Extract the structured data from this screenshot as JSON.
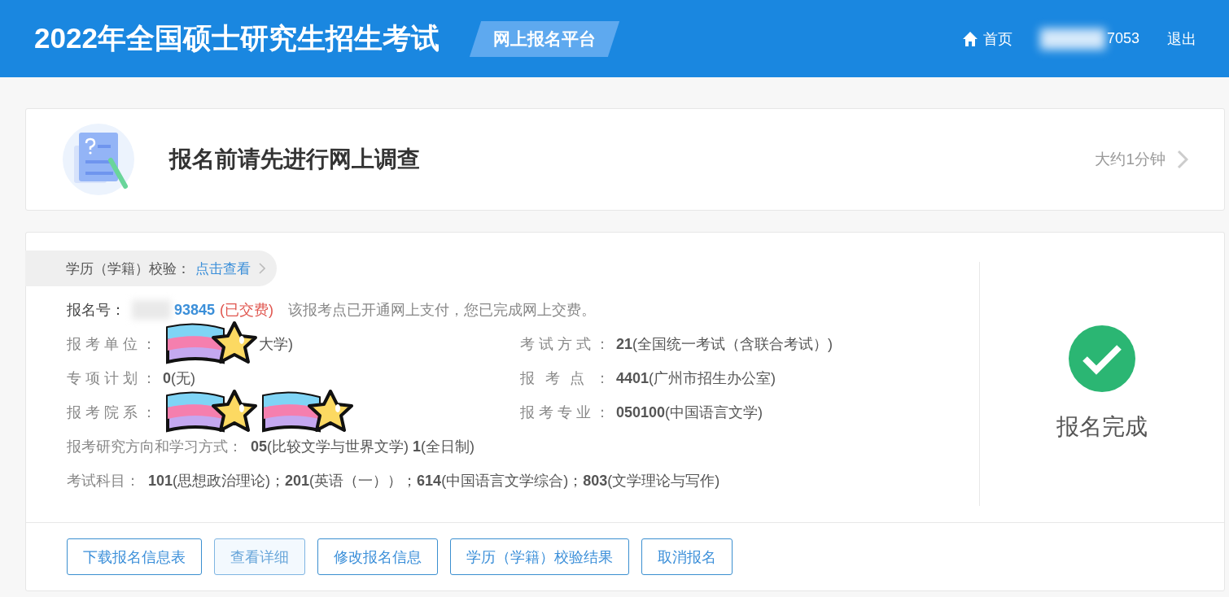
{
  "header": {
    "title": "2022年全国硕士研究生招生考试",
    "badge": "网上报名平台",
    "nav": [
      {
        "kind": "home",
        "label": "首页"
      },
      {
        "kind": "user",
        "label": "7053",
        "blurred": true
      },
      {
        "kind": "logout",
        "label": "退出"
      }
    ]
  },
  "survey": {
    "title": "报名前请先进行网上调查",
    "duration": "大约1分钟"
  },
  "registration": {
    "verify": {
      "label": "学历（学籍）校验：",
      "link": "点击查看"
    },
    "number": {
      "label": "报名号：",
      "value": "93845",
      "blurred": true,
      "status": "(已交费)",
      "paid": true,
      "note": "该报考点已开通网上支付，您已完成网上交费。"
    },
    "fields": [
      {
        "label": "报考单位：",
        "value": "大学)",
        "stickers_over": [
          {
            "kind": "sticker"
          }
        ]
      },
      {
        "label": "考试方式：",
        "value": "**21**(全国统一考试（含联合考试）)"
      },
      {
        "label": "专项计划：",
        "value": "**0**(无)"
      },
      {
        "label": "报考点：",
        "value": "**4401**(广州市招生办公室)"
      },
      {
        "label": "报考院系：",
        "stickers_over": [
          {
            "kind": "sticker"
          },
          {
            "kind": "sticker"
          }
        ]
      },
      {
        "label": "报考专业：",
        "value": "**050100**(中国语言文学)"
      }
    ],
    "lines": [
      {
        "label": "报考研究方向和学习方式：",
        "value": "**05**(比较文学与世界文学) **1**(全日制)"
      },
      {
        "label": "考试科目：",
        "value": "**101**(思想政治理论)；**201**(英语（一））；**614**(中国语言文学综合)；**803**(文学理论与写作)"
      }
    ],
    "result": {
      "label": "报名完成",
      "done": true
    },
    "buttons": [
      {
        "label": "下载报名信息表",
        "selected": false
      },
      {
        "label": "查看详细",
        "selected": true
      },
      {
        "label": "修改报名信息",
        "selected": false
      },
      {
        "label": "学历（学籍）校验结果",
        "selected": false
      },
      {
        "label": "取消报名",
        "selected": false
      }
    ]
  }
}
